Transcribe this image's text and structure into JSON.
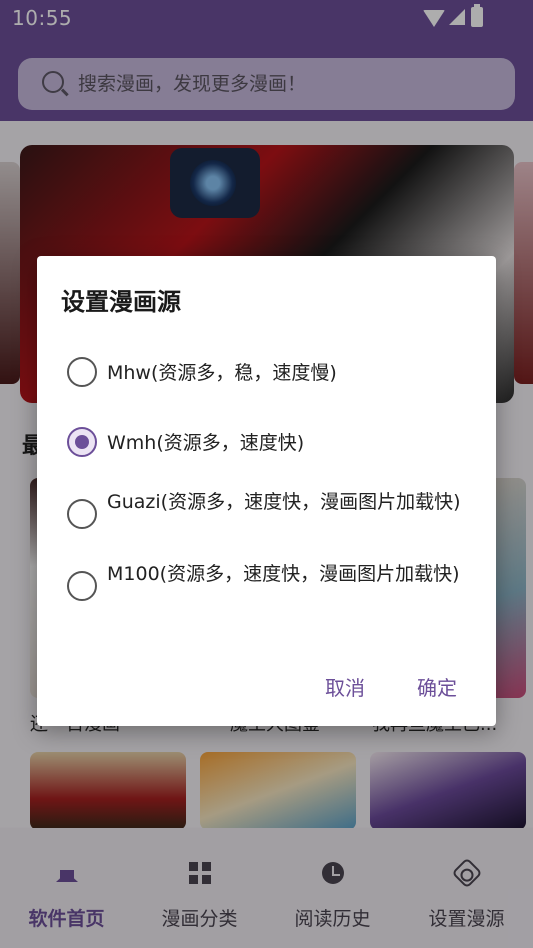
{
  "status_bar": {
    "time": "10:55"
  },
  "search": {
    "placeholder": "搜索漫画，发现更多漫画！"
  },
  "section": {
    "title": "最"
  },
  "cards": {
    "titles": [
      "还一百漫画",
      "魔王大图鉴",
      "我再些魔王已..."
    ]
  },
  "bottom_nav": {
    "items": [
      {
        "label": "软件首页",
        "icon": "home-icon",
        "active": true
      },
      {
        "label": "漫画分类",
        "icon": "grid-icon",
        "active": false
      },
      {
        "label": "阅读历史",
        "icon": "clock-icon",
        "active": false
      },
      {
        "label": "设置漫源",
        "icon": "gear-icon",
        "active": false
      }
    ]
  },
  "dialog": {
    "title": "设置漫画源",
    "options": [
      {
        "label": "Mhw(资源多，稳，速度慢)",
        "selected": false
      },
      {
        "label": "Wmh(资源多，速度快)",
        "selected": true
      },
      {
        "label": "Guazi(资源多，速度快，漫画图片加载快)",
        "selected": false
      },
      {
        "label": "M100(资源多，速度快，漫画图片加载快)",
        "selected": false
      }
    ],
    "cancel_label": "取消",
    "confirm_label": "确定"
  },
  "colors": {
    "accent": "#6c4f99",
    "topbar": "#6c4f99",
    "search_bg": "#c6b9dc"
  }
}
